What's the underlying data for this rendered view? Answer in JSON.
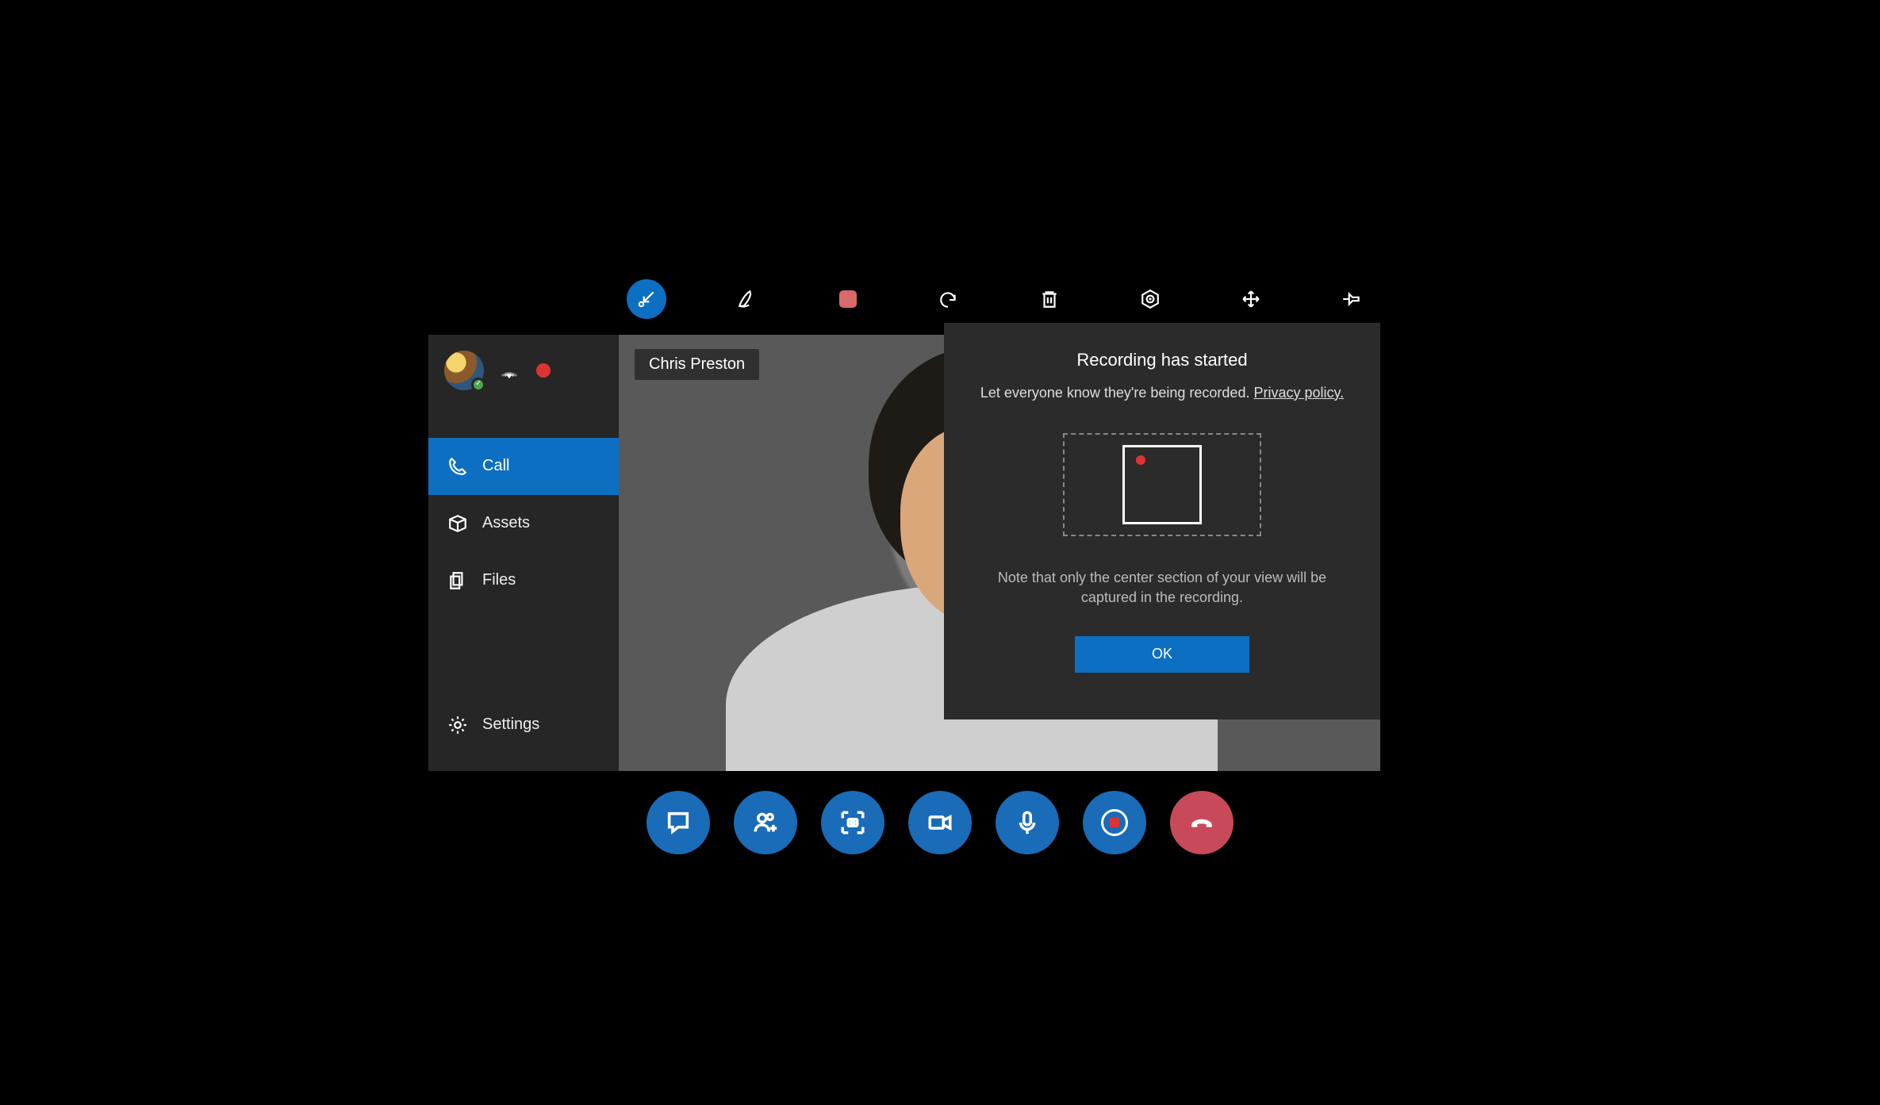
{
  "toolbar": {
    "icons": {
      "minimize": "minimize-icon",
      "ink": "ink-icon",
      "stop": "stop-icon",
      "undo": "undo-icon",
      "delete": "delete-icon",
      "locate": "locate-icon",
      "move": "move-icon",
      "pin": "pin-icon"
    }
  },
  "sidebar": {
    "status": "online",
    "recording_indicator": "recording-dot",
    "items": [
      {
        "icon": "phone-icon",
        "label": "Call",
        "active": true
      },
      {
        "icon": "box-icon",
        "label": "Assets",
        "active": false
      },
      {
        "icon": "files-icon",
        "label": "Files",
        "active": false
      }
    ],
    "settings": {
      "icon": "gear-icon",
      "label": "Settings"
    }
  },
  "video": {
    "participant_name": "Chris Preston"
  },
  "dialog": {
    "title": "Recording has started",
    "subtitle_prefix": "Let everyone know they're being recorded. ",
    "privacy_link": "Privacy policy.",
    "note": "Note that only the center section of your view will be captured in the recording.",
    "ok_label": "OK"
  },
  "bottombar": {
    "buttons": {
      "chat": "chat-icon",
      "people": "add-people-icon",
      "capture": "capture-icon",
      "video": "video-icon",
      "mic": "mic-icon",
      "record": "record-icon",
      "hangup": "hangup-icon"
    }
  },
  "colors": {
    "accent": "#0d6fc1",
    "hangup": "#c84a5a",
    "record_red": "#d33",
    "panel": "#262626",
    "dialog": "#2b2b2b"
  }
}
